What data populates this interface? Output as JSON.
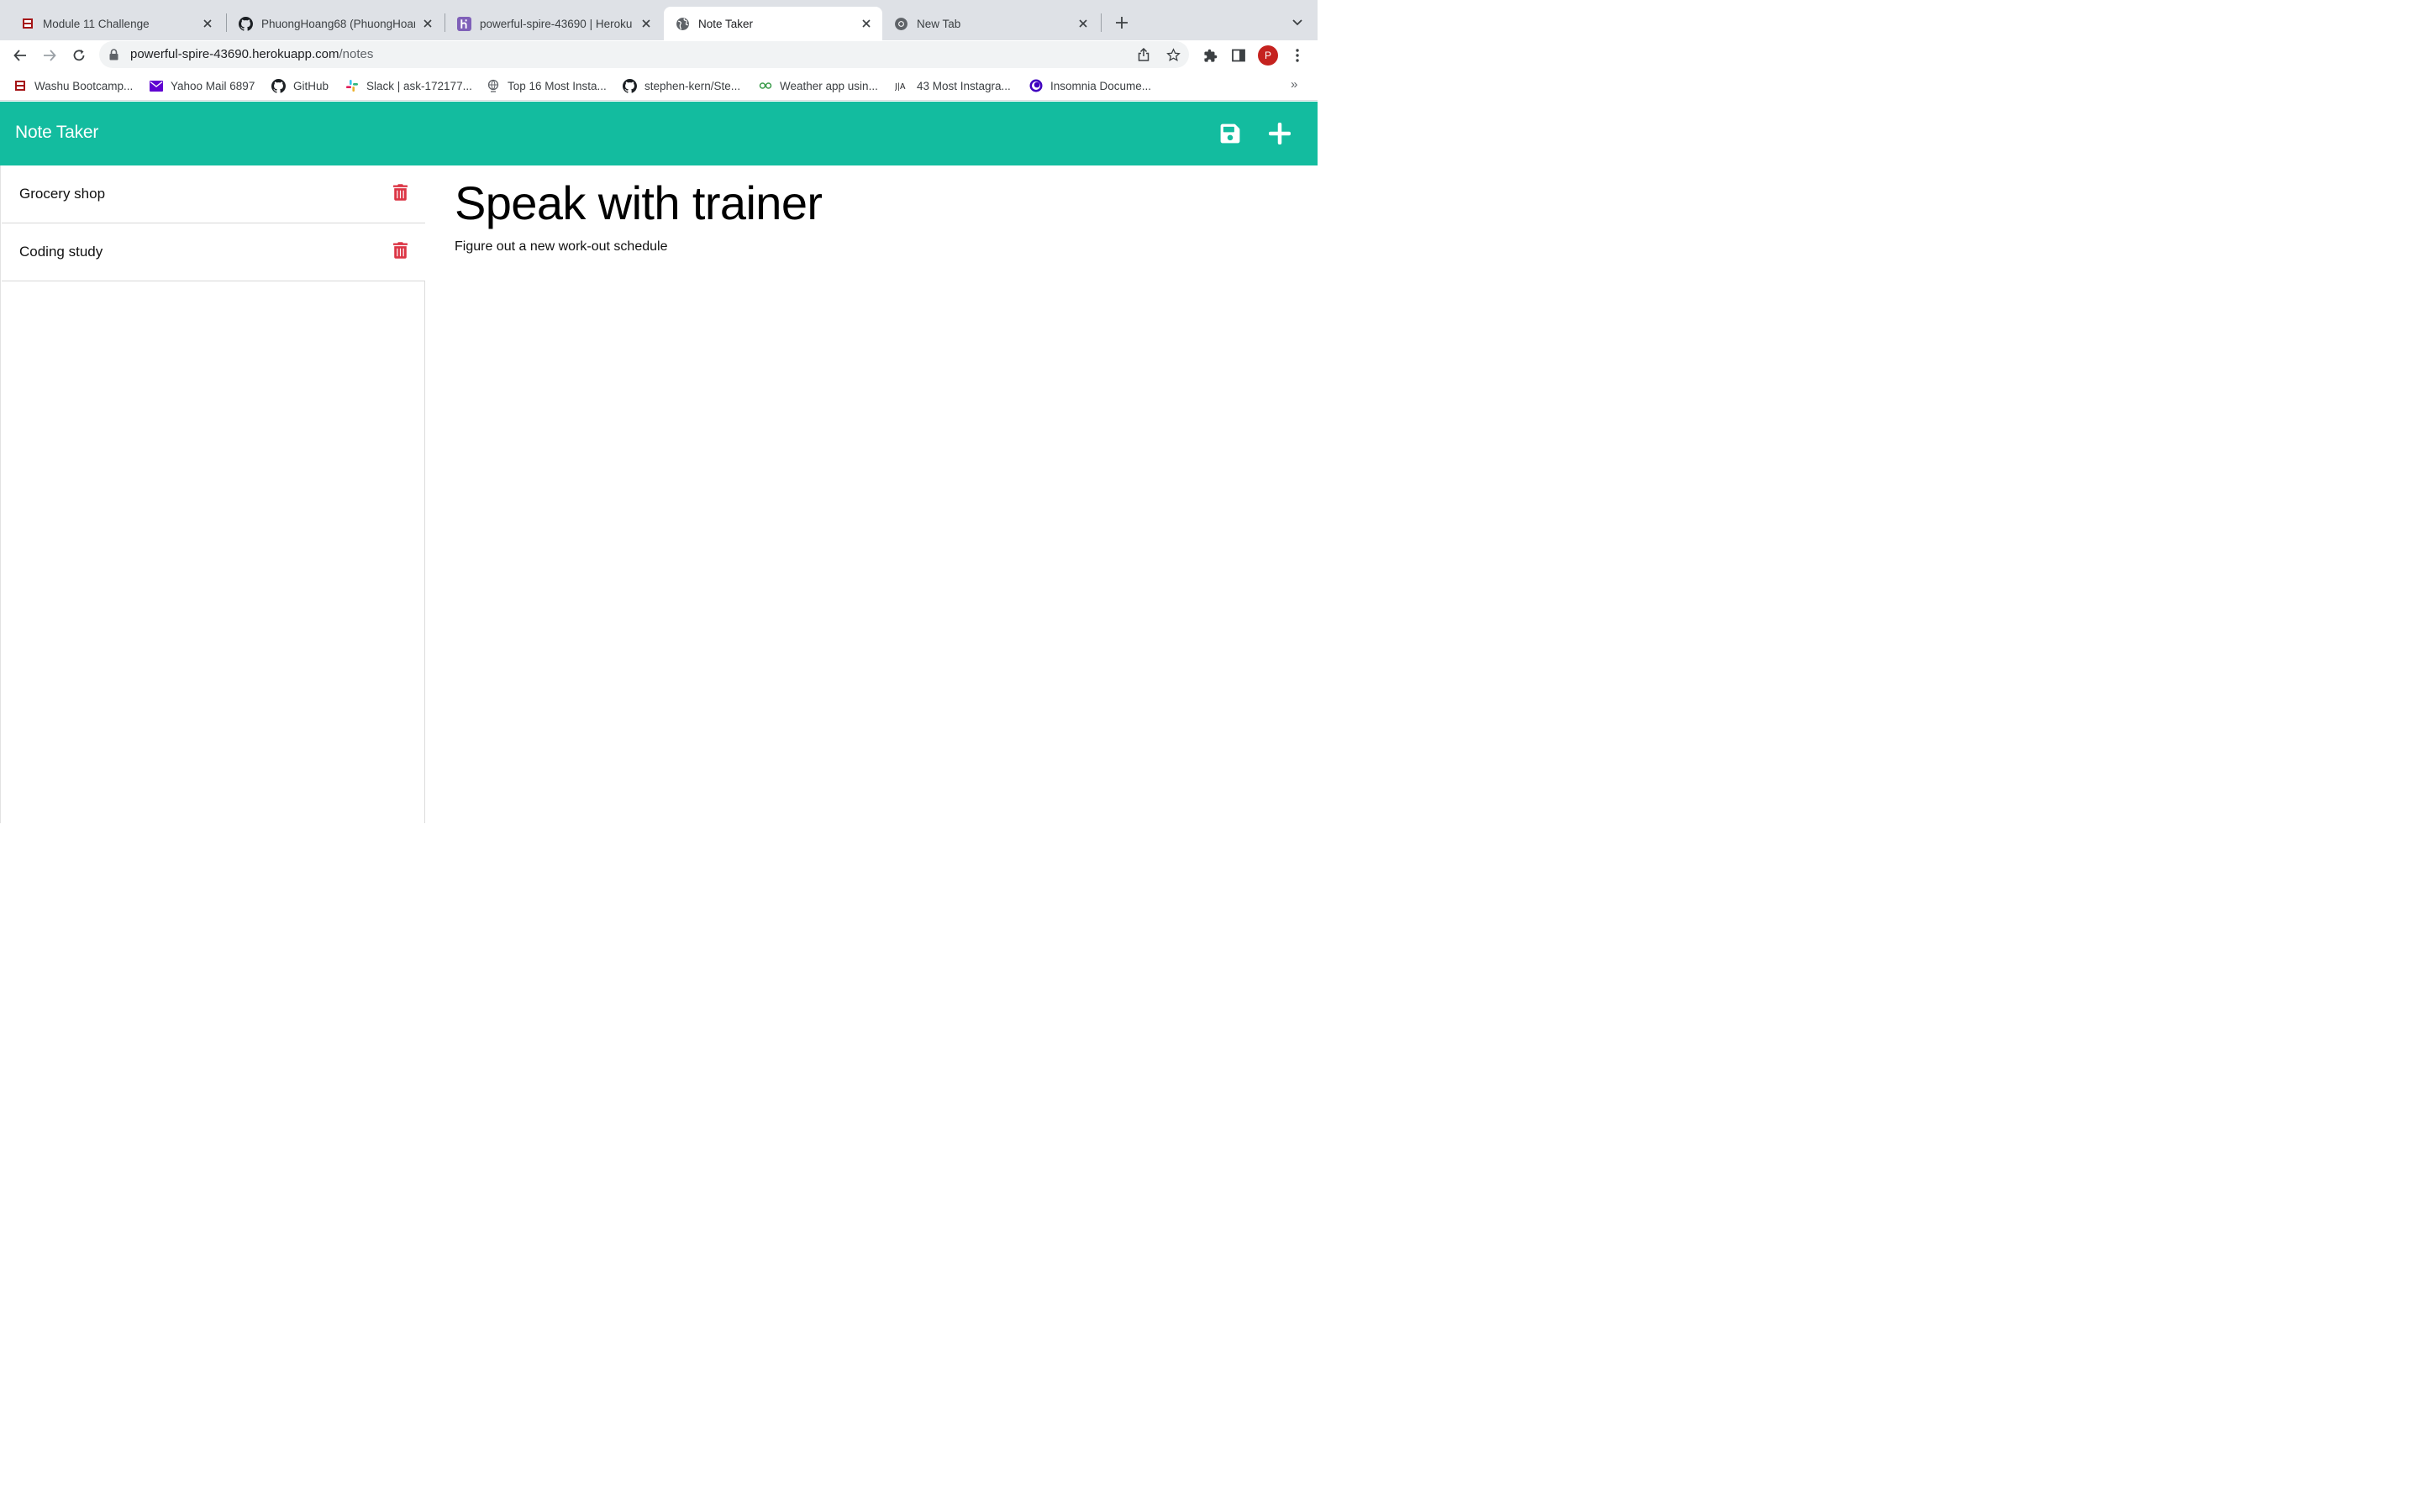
{
  "browser": {
    "tabs": [
      {
        "title": "Module 11 Challenge",
        "icon": "washu-icon",
        "active": false
      },
      {
        "title": "PhuongHoang68 (PhuongHoang68)",
        "icon": "github-icon",
        "active": false
      },
      {
        "title": "powerful-spire-43690 | Heroku",
        "icon": "heroku-icon",
        "active": false
      },
      {
        "title": "Note Taker",
        "icon": "globe-icon",
        "active": true
      },
      {
        "title": "New Tab",
        "icon": "chrome-icon",
        "active": false
      }
    ],
    "url": {
      "host": "powerful-spire-43690.herokuapp.com",
      "path": "/notes"
    },
    "profile_initial": "P",
    "bookmarks": [
      {
        "label": "Washu Bootcamp...",
        "icon": "washu-icon"
      },
      {
        "label": "Yahoo Mail 6897",
        "icon": "mail-icon"
      },
      {
        "label": "GitHub",
        "icon": "github-icon"
      },
      {
        "label": "Slack | ask-172177...",
        "icon": "slack-icon"
      },
      {
        "label": "Top 16 Most Insta...",
        "icon": "globe-icon"
      },
      {
        "label": "stephen-kern/Ste...",
        "icon": "github-icon"
      },
      {
        "label": "Weather app usin...",
        "icon": "link-icon"
      },
      {
        "label": "43 Most Instagra...",
        "icon": "ja-icon"
      },
      {
        "label": "Insomnia Docume...",
        "icon": "insomnia-icon"
      }
    ],
    "bookmarks_more": "»"
  },
  "app": {
    "brand": "Note Taker",
    "accent_color": "#13bc9f",
    "delete_color": "#dc3545",
    "notes": [
      {
        "title": "Grocery shop"
      },
      {
        "title": "Coding study"
      }
    ],
    "active_note": {
      "title": "Speak with trainer",
      "text": "Figure out a new work-out schedule"
    }
  }
}
